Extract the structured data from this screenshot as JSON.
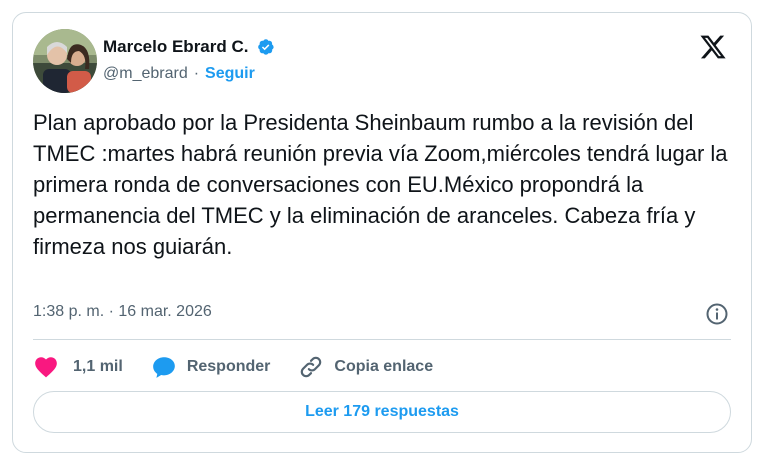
{
  "author": {
    "name": "Marcelo Ebrard C.",
    "handle": "@m_ebrard",
    "separator": "·",
    "follow_label": "Seguir"
  },
  "tweet": {
    "text": "Plan aprobado por la Presidenta Sheinbaum rumbo a la revisión del TMEC :martes habrá reunión previa vía Zoom,miércoles tendrá lugar la primera ronda de conversaciones con EU.México propondrá la permanencia del TMEC y la eliminación de aranceles. Cabeza fría y firmeza nos guiarán.",
    "timestamp": "1:38 p. m. · 16 mar. 2026"
  },
  "actions": {
    "likes": "1,1 mil",
    "reply_label": "Responder",
    "copy_link_label": "Copia enlace"
  },
  "read_replies_label": "Leer 179 respuestas",
  "colors": {
    "accent": "#1d9bf0",
    "like": "#f91880",
    "text": "#0f1419",
    "muted": "#536471",
    "border": "#cfd9de"
  },
  "icons": [
    "verified-badge-icon",
    "x-logo-icon",
    "info-icon",
    "heart-icon",
    "reply-bubble-icon",
    "link-icon"
  ]
}
